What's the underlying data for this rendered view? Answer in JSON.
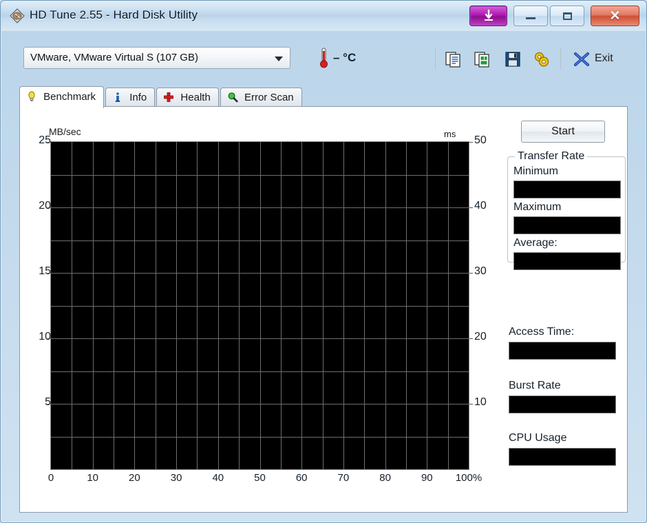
{
  "window": {
    "title": "HD Tune 2.55 - Hard Disk Utility",
    "app_icon": "hard-disk-icon",
    "buttons": {
      "download": "download-arrow-icon",
      "minimize": "minimize-icon",
      "maximize": "maximize-icon",
      "close": "✕"
    }
  },
  "toolbar": {
    "drive_selected": "VMware, VMware Virtual S (107 GB)",
    "thermometer_icon": "thermometer-icon",
    "temperature": "– °C",
    "copy_text_icon": "copy-text-icon",
    "copy_image_icon": "copy-image-icon",
    "save_icon": "save-floppy-icon",
    "options_icon": "options-gears-icon",
    "exit_icon": "exit-x-icon",
    "exit_label": "Exit"
  },
  "tabs": [
    {
      "label": "Benchmark",
      "icon": "lightbulb-icon",
      "active": true
    },
    {
      "label": "Info",
      "icon": "info-icon",
      "active": false
    },
    {
      "label": "Health",
      "icon": "red-cross-icon",
      "active": false
    },
    {
      "label": "Error Scan",
      "icon": "magnifier-icon",
      "active": false
    }
  ],
  "benchmark": {
    "start_button": "Start",
    "transfer_rate": {
      "legend": "Transfer Rate",
      "minimum_label": "Minimum",
      "minimum_value": "",
      "maximum_label": "Maximum",
      "maximum_value": "",
      "average_label": "Average:",
      "average_value": ""
    },
    "access_time_label": "Access Time:",
    "access_time_value": "",
    "burst_rate_label": "Burst Rate",
    "burst_rate_value": "",
    "cpu_usage_label": "CPU Usage",
    "cpu_usage_value": ""
  },
  "chart_data": {
    "type": "line",
    "title": "",
    "xlabel": "",
    "ylabel": "MB/sec",
    "y2label": "ms",
    "xlim": [
      0,
      100
    ],
    "ylim": [
      0,
      25
    ],
    "y2lim": [
      0,
      50
    ],
    "xticks": [
      "0",
      "10",
      "20",
      "30",
      "40",
      "50",
      "60",
      "70",
      "80",
      "90",
      "100%"
    ],
    "xtick_values": [
      0,
      10,
      20,
      30,
      40,
      50,
      60,
      70,
      80,
      90,
      100
    ],
    "yticks": [
      "5",
      "10",
      "15",
      "20",
      "25"
    ],
    "ytick_values": [
      5,
      10,
      15,
      20,
      25
    ],
    "y2ticks": [
      "10",
      "20",
      "30",
      "40",
      "50"
    ],
    "y2tick_values": [
      10,
      20,
      30,
      40,
      50
    ],
    "grid": true,
    "grid_color": "#6e6e6e",
    "plot_bgcolor": "#000000",
    "grid_x_step": 5,
    "grid_y_step": 2.5,
    "legend": [],
    "series": [
      {
        "name": "Transfer rate",
        "color": "#ffff00",
        "x": [],
        "values": []
      },
      {
        "name": "Access time",
        "color": "#ff0000",
        "x": [],
        "values": []
      }
    ],
    "note": "Benchmark not yet run — plot area is empty"
  },
  "colors": {
    "accent_magenta": "#b218b2",
    "close_red": "#cf4f33",
    "plot_black": "#000000",
    "grid_gray": "#6e6e6e",
    "frame_blue": "#bad5e8"
  }
}
